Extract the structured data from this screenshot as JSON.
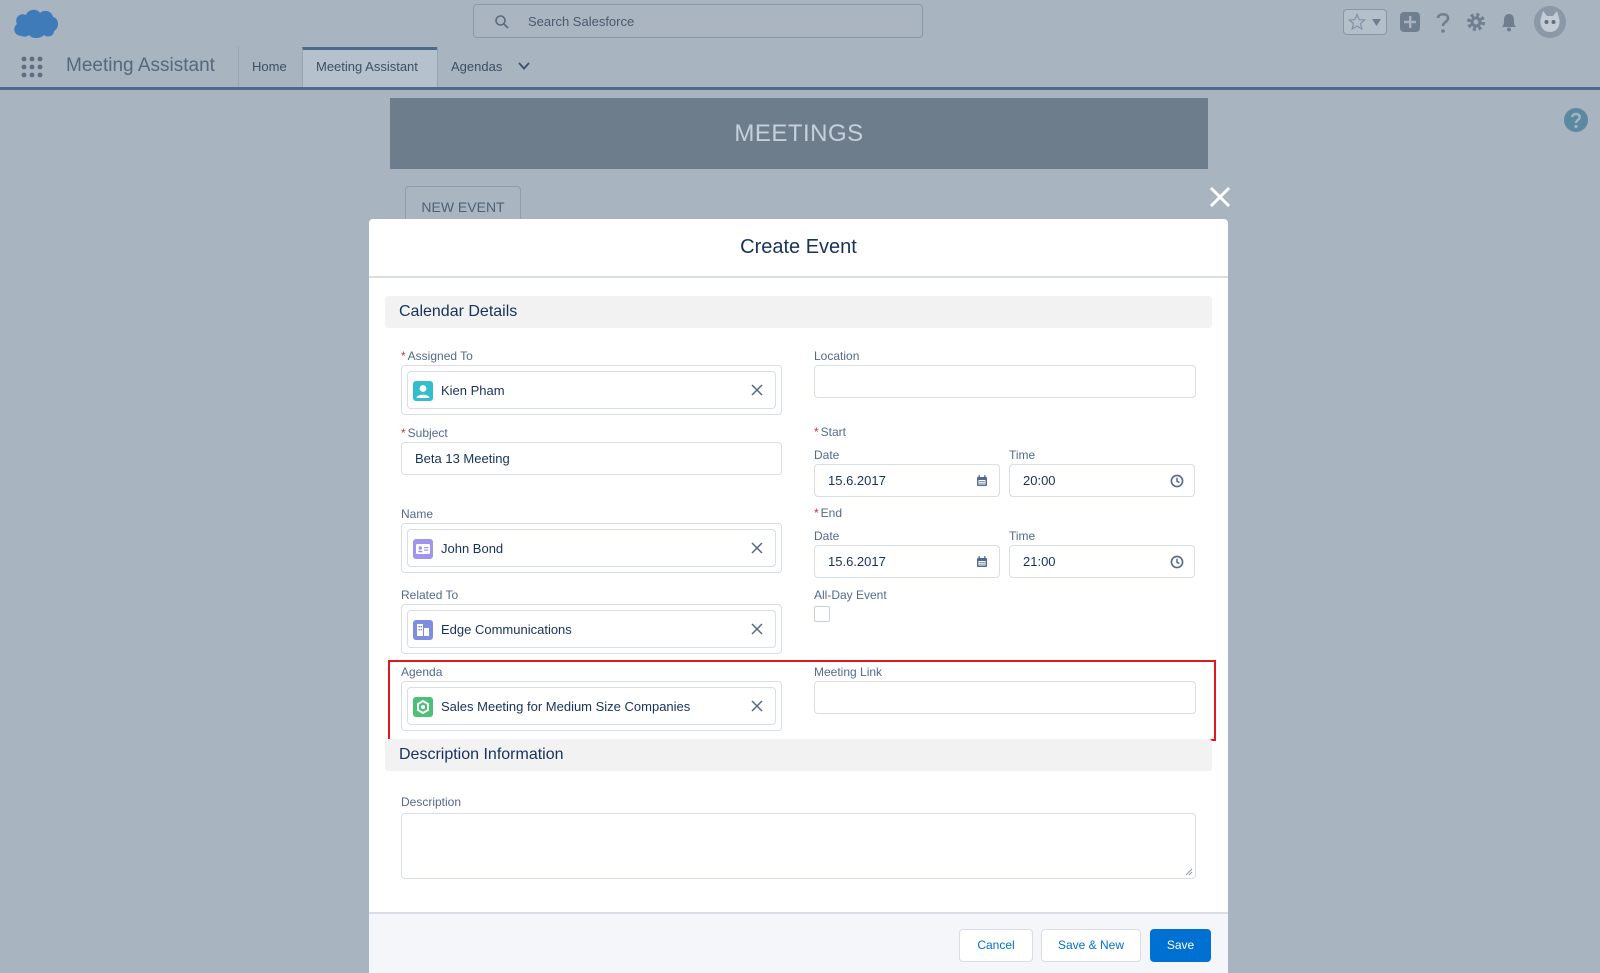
{
  "header": {
    "search_placeholder": "Search Salesforce"
  },
  "nav": {
    "app_name": "Meeting Assistant",
    "tabs": [
      {
        "label": "Home"
      },
      {
        "label": "Meeting Assistant"
      },
      {
        "label": "Agendas"
      }
    ]
  },
  "page": {
    "banner_title": "MEETINGS",
    "new_event_label": "NEW EVENT"
  },
  "modal": {
    "title": "Create Event",
    "sections": {
      "calendar": "Calendar Details",
      "description": "Description Information"
    },
    "fields": {
      "assigned_to": {
        "label": "Assigned To",
        "required": "*",
        "value": "Kien Pham"
      },
      "subject": {
        "label": "Subject",
        "required": "*",
        "value": "Beta 13 Meeting"
      },
      "name": {
        "label": "Name",
        "value": "John Bond"
      },
      "related_to": {
        "label": "Related To",
        "value": "Edge Communications"
      },
      "agenda": {
        "label": "Agenda",
        "value": "Sales Meeting for Medium Size Companies"
      },
      "location": {
        "label": "Location",
        "value": ""
      },
      "start": {
        "label": "Start",
        "required": "*",
        "date_label": "Date",
        "date": "15.6.2017",
        "time_label": "Time",
        "time": "20:00"
      },
      "end": {
        "label": "End",
        "required": "*",
        "date_label": "Date",
        "date": "15.6.2017",
        "time_label": "Time",
        "time": "21:00"
      },
      "all_day": {
        "label": "All-Day Event"
      },
      "meeting_link": {
        "label": "Meeting Link",
        "value": ""
      },
      "description": {
        "label": "Description",
        "value": ""
      }
    },
    "footer": {
      "cancel": "Cancel",
      "save_new": "Save & New",
      "save": "Save"
    }
  },
  "colors": {
    "brand": "#0070d2",
    "highlight": "#e0191f",
    "user_icon": "#34becd",
    "contact_icon": "#a094ed",
    "account_icon": "#7f8de1",
    "agenda_icon": "#4bc076"
  }
}
